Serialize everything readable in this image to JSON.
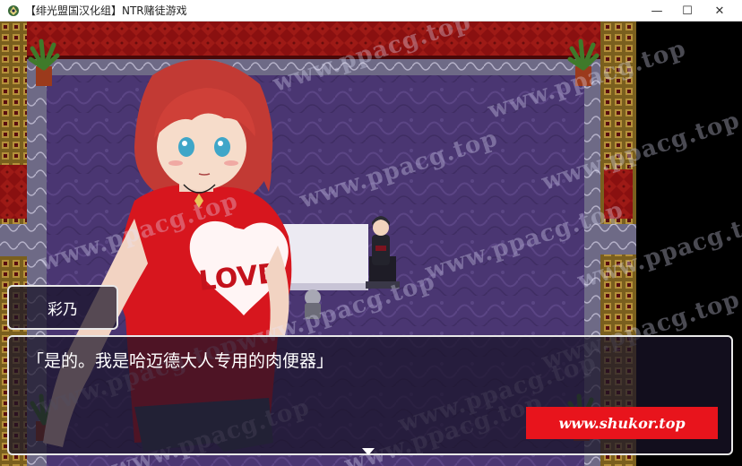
{
  "window": {
    "title": "【绯光盟国汉化组】NTR赌徒游戏",
    "minimize_glyph": "—",
    "maximize_glyph": "☐",
    "close_glyph": "✕",
    "app_icon": "game-app-icon"
  },
  "dialogue": {
    "speaker": "彩乃",
    "message": "「是的。我是哈迈德大人专用的肉便器」",
    "continue_icon": "next-arrow-icon"
  },
  "character": {
    "shirt_text": "LOVE"
  },
  "watermark": {
    "text": "www.ppacg.top"
  },
  "ad_banner": {
    "text": "www.shukor.top"
  },
  "colors": {
    "carpet": "#4a3672",
    "wall_red": "#8a1010",
    "frame_gold": "#a0822e",
    "banner_red": "#e8141c"
  }
}
